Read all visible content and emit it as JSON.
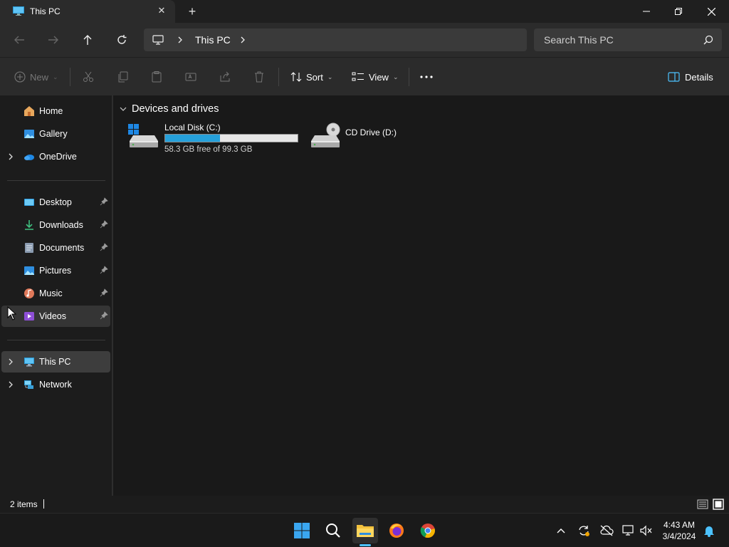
{
  "window": {
    "tab_title": "This PC",
    "tab_close": "✕",
    "new_tab": "+"
  },
  "address": {
    "breadcrumb": [
      "This PC"
    ],
    "search_placeholder": "Search This PC"
  },
  "commands": {
    "new_label": "New",
    "sort_label": "Sort",
    "view_label": "View",
    "details_label": "Details"
  },
  "sidebar": {
    "items": [
      {
        "label": "Home",
        "icon": "home-icon",
        "expandable": false
      },
      {
        "label": "Gallery",
        "icon": "gallery-icon",
        "expandable": false
      },
      {
        "label": "OneDrive",
        "icon": "onedrive-icon",
        "expandable": true
      }
    ],
    "quick_access": [
      {
        "label": "Desktop",
        "icon": "desktop-icon",
        "pinned": true
      },
      {
        "label": "Downloads",
        "icon": "downloads-icon",
        "pinned": true
      },
      {
        "label": "Documents",
        "icon": "documents-icon",
        "pinned": true
      },
      {
        "label": "Pictures",
        "icon": "pictures-icon",
        "pinned": true
      },
      {
        "label": "Music",
        "icon": "music-icon",
        "pinned": true
      },
      {
        "label": "Videos",
        "icon": "videos-icon",
        "pinned": true
      }
    ],
    "locations": [
      {
        "label": "This PC",
        "icon": "this-pc-icon",
        "expandable": true,
        "selected": true
      },
      {
        "label": "Network",
        "icon": "network-icon",
        "expandable": true
      }
    ]
  },
  "content": {
    "group_title": "Devices and drives",
    "drives": [
      {
        "name": "Local Disk (C:)",
        "free_text": "58.3 GB free of 99.3 GB",
        "used_fraction": 0.413
      },
      {
        "name": "CD Drive (D:)"
      }
    ]
  },
  "status": {
    "items_text": "2 items"
  },
  "taskbar": {
    "time": "4:43 AM",
    "date": "3/4/2024"
  },
  "colors": {
    "accent": "#4cc2ff",
    "drive_bar_fill": "#26a0da",
    "background": "#191919"
  }
}
